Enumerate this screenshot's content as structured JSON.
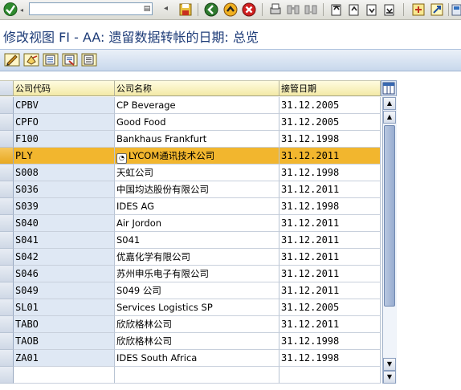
{
  "title": "修改视图 FI - AA: 遗留数据转帐的日期: 总览",
  "command_field": {
    "value": "",
    "history_glyph": "▤"
  },
  "std_toolbar": [
    "back-arrow-icon",
    "save-icon",
    "back-icon",
    "exit-icon",
    "cancel-icon",
    "print-icon",
    "find-icon",
    "find-next-icon",
    "first-page-icon",
    "previous-page-icon",
    "next-page-icon",
    "last-page-icon",
    "create-session-icon",
    "help-icon"
  ],
  "app_toolbar": [
    "display-change-icon",
    "undo-icon",
    "copy-as-icon",
    "delete-icon",
    "select-all-icon"
  ],
  "table": {
    "headers": [
      "公司代码",
      "公司名称",
      "接管日期"
    ],
    "rows": [
      {
        "code": "CPBV",
        "name": "CP Beverage",
        "date": "31.12.2005"
      },
      {
        "code": "CPFO",
        "name": "Good Food",
        "date": "31.12.2005"
      },
      {
        "code": "F100",
        "name": "Bankhaus Frankfurt",
        "date": "31.12.1998"
      },
      {
        "code": "PLY",
        "name": "LYCOM通讯技术公司",
        "date": "31.12.2011",
        "selected": true
      },
      {
        "code": "S008",
        "name": "天虹公司",
        "date": "31.12.1998"
      },
      {
        "code": "S036",
        "name": "中国均达股份有限公司",
        "date": "31.12.2011"
      },
      {
        "code": "S039",
        "name": "IDES AG",
        "date": "31.12.1998"
      },
      {
        "code": "S040",
        "name": "Air Jordon",
        "date": "31.12.2011"
      },
      {
        "code": "S041",
        "name": "S041",
        "date": "31.12.2011"
      },
      {
        "code": "S042",
        "name": "优嘉化学有限公司",
        "date": "31.12.2011"
      },
      {
        "code": "S046",
        "name": "苏州申乐电子有限公司",
        "date": "31.12.2011"
      },
      {
        "code": "S049",
        "name": "S049 公司",
        "date": "31.12.2011"
      },
      {
        "code": "SL01",
        "name": "Services Logistics SP",
        "date": "31.12.2005"
      },
      {
        "code": "TABO",
        "name": "欣欣格林公司",
        "date": "31.12.2011"
      },
      {
        "code": "TAOB",
        "name": "欣欣格林公司",
        "date": "31.12.1998"
      },
      {
        "code": "ZA01",
        "name": "IDES South Africa",
        "date": "31.12.1998"
      },
      {
        "code": "",
        "name": "",
        "date": ""
      }
    ],
    "scroll_position": 0.78
  }
}
